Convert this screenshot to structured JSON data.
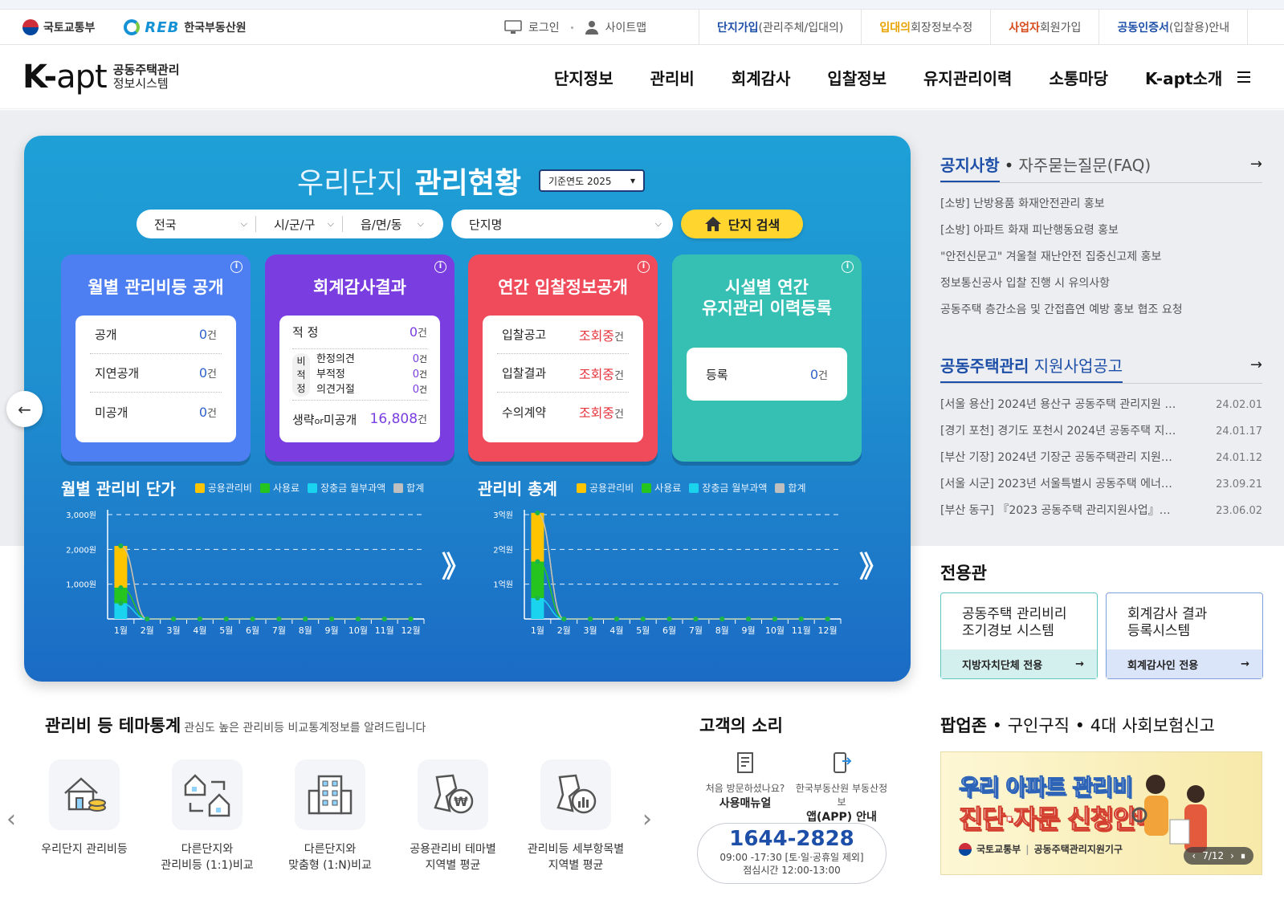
{
  "util": {
    "logo1": "국토교통부",
    "logo2_mark": "REB",
    "logo2": "한국부동산원",
    "login": "로그인",
    "sitemap": "사이트맵",
    "links": [
      {
        "strong": "단지가입",
        "rest": "(관리주체/입대의)",
        "color": "#1d4fa8"
      },
      {
        "strong": "입대의",
        "rest": "회장정보수정",
        "color": "#e8a400"
      },
      {
        "strong": "사업자",
        "rest": " 회원가입",
        "color": "#d64a1c"
      },
      {
        "strong": "공동인증서",
        "rest": " (입찰용)안내",
        "color": "#1d4fa8"
      }
    ]
  },
  "header": {
    "brand_k": "K-",
    "brand_apt": "apt",
    "brand_sub1": "공동주택관리",
    "brand_sub2": "정보시스템",
    "nav": [
      "단지정보",
      "관리비",
      "회계감사",
      "입찰정보",
      "유지관리이력",
      "소통마당",
      "K-apt소개"
    ]
  },
  "main": {
    "title_light": "우리단지",
    "title_bold": "관리현황",
    "year_label": "기준연도 2025",
    "region": [
      "전국",
      "시/군/구",
      "읍/면/동"
    ],
    "complex_placeholder": "단지명",
    "search_label": "단지 검색",
    "tiles": {
      "t1": {
        "title": "월별 관리비등 공개",
        "rows": [
          {
            "k": "공개",
            "v": "0",
            "u": "건"
          },
          {
            "k": "지연공개",
            "v": "0",
            "u": "건"
          },
          {
            "k": "미공개",
            "v": "0",
            "u": "건"
          }
        ]
      },
      "t2": {
        "title": "회계감사결과",
        "ok_k": "적 정",
        "ok_v": "0",
        "u": "건",
        "non_side": [
          "비",
          "적",
          "정"
        ],
        "non": [
          {
            "k": "한정의견",
            "v": "0"
          },
          {
            "k": "부적정",
            "v": "0"
          },
          {
            "k": "의견거절",
            "v": "0"
          }
        ],
        "last_a": "생략",
        "last_or": "or",
        "last_b": "미공개",
        "last_v": "16,808"
      },
      "t3": {
        "title": "연간 입찰정보공개",
        "rows": [
          {
            "k": "입찰공고",
            "v": "조회중",
            "u": "건"
          },
          {
            "k": "입찰결과",
            "v": "조회중",
            "u": "건"
          },
          {
            "k": "수의계약",
            "v": "조회중",
            "u": "건"
          }
        ]
      },
      "t4": {
        "title1": "시설별 연간",
        "title2": "유지관리 이력등록",
        "k": "등록",
        "v": "0",
        "u": "건"
      }
    },
    "legend": [
      "공용관리비",
      "사용료",
      "장충금 월부과액",
      "합계"
    ],
    "legend_colors": [
      "#ffc400",
      "#25c41f",
      "#19d3ef",
      "#bfbfbf"
    ]
  },
  "chart_data": [
    {
      "type": "bar",
      "title": "월별 관리비 단가",
      "categories": [
        "1월",
        "2월",
        "3월",
        "4월",
        "5월",
        "6월",
        "7월",
        "8월",
        "9월",
        "10월",
        "11월",
        "12월"
      ],
      "yticks": [
        "1,000원",
        "2,000원",
        "3,000원"
      ],
      "ylim": [
        0,
        3000
      ],
      "series": [
        {
          "name": "장충금 월부과액",
          "values": [
            450,
            0,
            0,
            0,
            0,
            0,
            0,
            0,
            0,
            0,
            0,
            0
          ]
        },
        {
          "name": "사용료",
          "values": [
            450,
            0,
            0,
            0,
            0,
            0,
            0,
            0,
            0,
            0,
            0,
            0
          ]
        },
        {
          "name": "공용관리비",
          "values": [
            1200,
            0,
            0,
            0,
            0,
            0,
            0,
            0,
            0,
            0,
            0,
            0
          ]
        },
        {
          "name": "합계",
          "values": [
            2100,
            0,
            0,
            0,
            0,
            0,
            0,
            0,
            0,
            0,
            0,
            0
          ]
        }
      ]
    },
    {
      "type": "bar",
      "title": "관리비 총계",
      "categories": [
        "1월",
        "2월",
        "3월",
        "4월",
        "5월",
        "6월",
        "7월",
        "8월",
        "9월",
        "10월",
        "11월",
        "12월"
      ],
      "yticks": [
        "1억원",
        "2억원",
        "3억원"
      ],
      "ylim": [
        0,
        3
      ],
      "series": [
        {
          "name": "장충금 월부과액",
          "values": [
            0.6,
            0,
            0,
            0,
            0,
            0,
            0,
            0,
            0,
            0,
            0,
            0
          ]
        },
        {
          "name": "사용료",
          "values": [
            1.05,
            0,
            0,
            0,
            0,
            0,
            0,
            0,
            0,
            0,
            0,
            0
          ]
        },
        {
          "name": "공용관리비",
          "values": [
            1.4,
            0,
            0,
            0,
            0,
            0,
            0,
            0,
            0,
            0,
            0,
            0
          ]
        },
        {
          "name": "합계",
          "values": [
            3.05,
            0,
            0,
            0,
            0,
            0,
            0,
            0,
            0,
            0,
            0,
            0
          ]
        }
      ]
    }
  ],
  "notice": {
    "tab_active": "공지사항",
    "tab_dim": "자주묻는질문(FAQ)",
    "items": [
      "[소방] 난방용품 화재안전관리 홍보",
      "[소방] 아파트 화재 피난행동요령 홍보",
      "\"안전신문고\" 겨울철 재난안전 집중신고제 홍보",
      "정보통신공사 입찰 진행 시 유의사항",
      "공동주택 층간소음 및 간접흡연 예방 홍보 협조 요청"
    ]
  },
  "support": {
    "title_a": "공동주택관리",
    "title_b": " 지원사업공고",
    "items": [
      {
        "t": "[서울 용산] 2024년 용산구 공동주택 관리지원 …",
        "d": "24.02.01"
      },
      {
        "t": "[경기 포천] 경기도 포천시 2024년 공동주택 지…",
        "d": "24.01.17"
      },
      {
        "t": "[부산 기장] 2024년 기장군 공동주택관리 지원…",
        "d": "24.01.12"
      },
      {
        "t": "[서울 시군] 2023년 서울특별시 공동주택 에너…",
        "d": "23.09.21"
      },
      {
        "t": "[부산 동구] 『2023 공동주택 관리지원사업』…",
        "d": "23.06.02"
      }
    ]
  },
  "dedicated": {
    "title": "전용관",
    "box1": {
      "l1": "공동주택 관리비리",
      "l2": "조기경보 시스템",
      "foot": "지방자치단체 전용"
    },
    "box2": {
      "l1": "회계감사 결과",
      "l2": "등록시스템",
      "foot": "회계감사인 전용"
    }
  },
  "themes": {
    "title": "관리비 등 테마통계",
    "desc": "관심도 높은 관리비등 비교통계정보를 알려드립니다",
    "items": [
      {
        "l1": "우리단지 관리비등",
        "l2": ""
      },
      {
        "l1": "다른단지와",
        "l2": "관리비등 (1:1)비교"
      },
      {
        "l1": "다른단지와",
        "l2": "맞춤형 (1:N)비교"
      },
      {
        "l1": "공용관리비 테마별",
        "l2": "지역별 평균"
      },
      {
        "l1": "관리비등 세부항목별",
        "l2": "지역별 평균"
      }
    ]
  },
  "cs": {
    "title": "고객의 소리",
    "i1_small": "처음 방문하셨나요?",
    "i1": "사용매뉴얼",
    "i2_small": "한국부동산원 부동산정보",
    "i2": "앱(APP) 안내",
    "phone": "1644-2828",
    "hours": "09:00 -17:30 [토·일·공휴일 제외]",
    "lunch": "점심시간 12:00-13:00"
  },
  "popup": {
    "title_a": "팝업존",
    "title_b": " • 구인구직 • 4대 사회보험신고",
    "b1": "우리 아파트 관리비",
    "b2": "진단·자문 신청안내",
    "f1": "국토교통부",
    "f2": "공동주택관리지원기구",
    "pager": "7/12"
  }
}
